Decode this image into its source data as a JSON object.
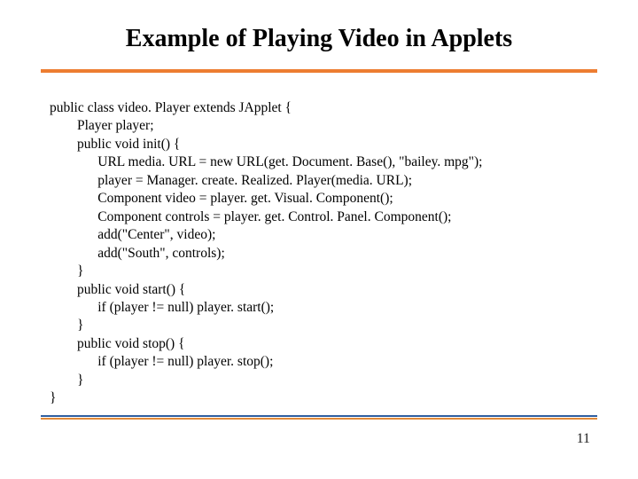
{
  "slide": {
    "title": "Example of Playing Video in Applets",
    "page_number": "11"
  },
  "code": {
    "l0": "public class video. Player extends JApplet {",
    "l1": "        Player player;",
    "l2": "        public void init() {",
    "l3": "              URL media. URL = new URL(get. Document. Base(), \"bailey. mpg\");",
    "l4": "              player = Manager. create. Realized. Player(media. URL);",
    "l5": "              Component video = player. get. Visual. Component();",
    "l6": "              Component controls = player. get. Control. Panel. Component();",
    "l7": "              add(\"Center\", video);",
    "l8": "              add(\"South\", controls);",
    "l9": "        }",
    "l10": "        public void start() {",
    "l11": "              if (player != null) player. start();",
    "l12": "        }",
    "l13": "        public void stop() {",
    "l14": "              if (player != null) player. stop();",
    "l15": "        }",
    "l16": "}"
  }
}
